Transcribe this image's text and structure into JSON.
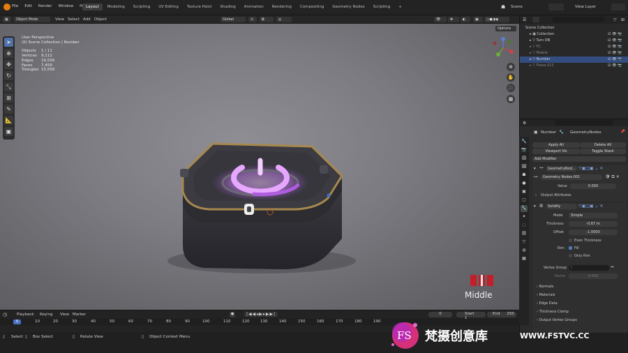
{
  "topbar": {
    "menus": [
      "File",
      "Edit",
      "Render",
      "Window",
      "Help"
    ],
    "workspaces": [
      "Layout",
      "Modeling",
      "Scripting",
      "UV Editing",
      "Texture Paint",
      "Shading",
      "Animation",
      "Rendering",
      "Compositing",
      "Geometry Nodes",
      "Scripting"
    ],
    "add_tab": "+",
    "scene": "Scene",
    "view_layer": "View Layer"
  },
  "header": {
    "mode": "Object Mode",
    "menus": [
      "View",
      "Select",
      "Add",
      "Object"
    ],
    "orientation": "Global",
    "options": "Options"
  },
  "overlay": {
    "view": "User Perspective",
    "collection": "(0) Scene Collection | Number",
    "stats": [
      {
        "k": "Objects",
        "v": "1 / 11"
      },
      {
        "k": "Vertices",
        "v": "9,112"
      },
      {
        "k": "Edges",
        "v": "16,556"
      },
      {
        "k": "Faces",
        "v": "7,459"
      },
      {
        "k": "Triangles",
        "v": "15,558"
      }
    ]
  },
  "corner_label": "Middle",
  "outliner": {
    "root": "Scene Collection",
    "items": [
      "Collection",
      "Turn ON",
      "PC",
      "Mobile",
      "Number",
      "Plane.013"
    ]
  },
  "properties": {
    "breadcrumb_obj": "Number",
    "breadcrumb_mod": "GeometryNodes",
    "search_placeholder": "",
    "apply_all": "Apply All",
    "delete_all": "Delete All",
    "viewport_vis": "Viewport Vis",
    "toggle_stack": "Toggle Stack",
    "add_modifier": "Add Modifier",
    "mod1_name": "GeometryNod...",
    "nodegroup": "Geometry Nodes.001",
    "value_label": "Value",
    "value": "0.000",
    "output_attrs": "Output Attributes",
    "mod2_name": "Solidify",
    "mode_label": "Mode",
    "mode": "Simple",
    "thickness_label": "Thickness",
    "thickness": "-0.67 m",
    "offset_label": "Offset",
    "offset": "-1.0000",
    "even": "Even Thickness",
    "rim_label": "Rim",
    "fill": "Fill",
    "only_rim": "Only Rim",
    "vgroup_label": "Vertex Group",
    "factor_label": "Factor",
    "factor": "0.000",
    "panels": [
      "Normals",
      "Materials",
      "Edge Data",
      "Thickness Clamp",
      "Output Vertex Groups"
    ]
  },
  "timeline": {
    "menus": [
      "Playback",
      "Keying",
      "View",
      "Marker"
    ],
    "current": "0",
    "start_label": "Start",
    "start": "1",
    "end_label": "End",
    "end": "250",
    "ticks": [
      "0",
      "10",
      "20",
      "30",
      "40",
      "50",
      "60",
      "70",
      "80",
      "90",
      "100",
      "110",
      "120",
      "130",
      "140",
      "150",
      "160",
      "170",
      "180",
      "190"
    ],
    "frame_marker": "0"
  },
  "status": {
    "select": "Select",
    "box_select": "Box Select",
    "rotate": "Rotate View",
    "context": "Object Context Menu"
  },
  "watermark": {
    "logo": "FS",
    "text": "梵摄创意库",
    "url": "WWW.FSTVC.CC"
  },
  "colors": {
    "accent": "#5072a8",
    "glow": "#d98bff",
    "panel": "#2b2b2b"
  }
}
